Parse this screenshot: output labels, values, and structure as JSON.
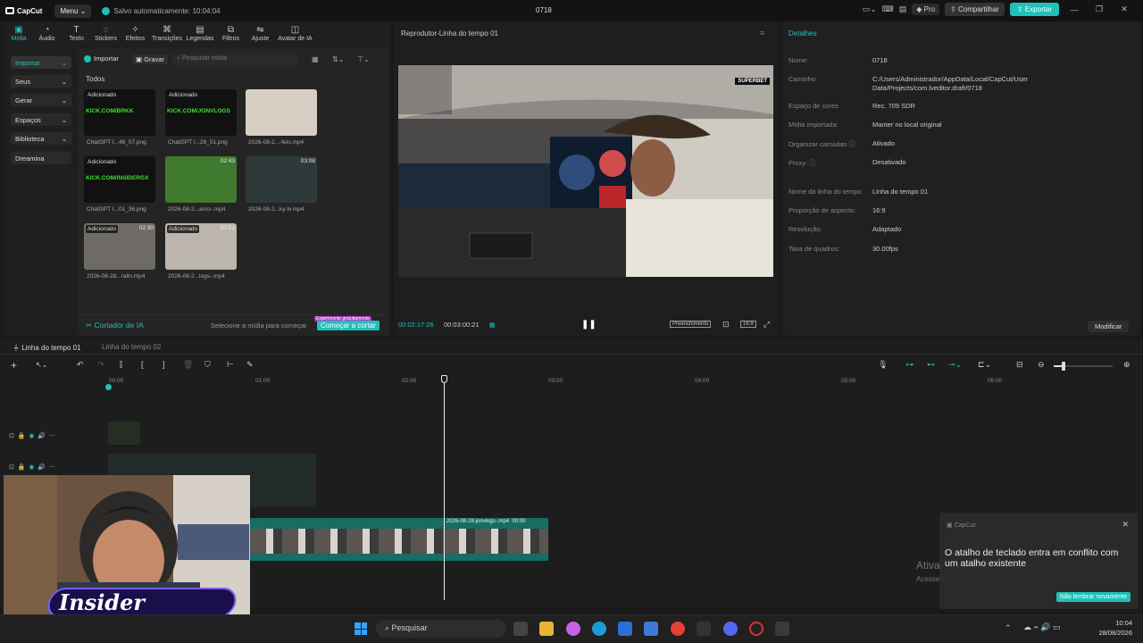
{
  "app": {
    "logo": "CapCut",
    "menu": "Menu",
    "autosave": "Salvo automaticamente: 10:04:04",
    "project_title": "0718",
    "pro": "Pro",
    "share": "Compartilhar",
    "export": "Exportar"
  },
  "tool_tabs": [
    {
      "label": "Mídia",
      "icon": "media-icon"
    },
    {
      "label": "Áudio",
      "icon": "audio-icon"
    },
    {
      "label": "Texto",
      "icon": "text-icon"
    },
    {
      "label": "Stickers",
      "icon": "sticker-icon"
    },
    {
      "label": "Efeitos",
      "icon": "effects-icon"
    },
    {
      "label": "Transições",
      "icon": "transition-icon"
    },
    {
      "label": "Legendas",
      "icon": "captions-icon"
    },
    {
      "label": "Filtros",
      "icon": "filter-icon"
    },
    {
      "label": "Ajuste",
      "icon": "adjust-icon"
    },
    {
      "label": "Avatar de IA",
      "icon": "avatar-icon"
    }
  ],
  "sidebar": {
    "items": [
      {
        "label": "Importar"
      },
      {
        "label": "Seus"
      },
      {
        "label": "Gerar"
      },
      {
        "label": "Espaços"
      },
      {
        "label": "Biblioteca"
      },
      {
        "label": "Dreamina"
      }
    ]
  },
  "media": {
    "import_btn": "Importar",
    "record_btn": "Gravar",
    "search_placeholder": "Pesquisar mídia",
    "section": "Todos",
    "items": [
      {
        "name": "ChatGPT I...48_07.png",
        "badge": "Adicionado",
        "overlay": "KICK.COM/BRKK",
        "duration": ""
      },
      {
        "name": "ChatGPT I...26_51.png",
        "badge": "Adicionado",
        "overlay": "KICK.COM/JONVLOGS",
        "duration": ""
      },
      {
        "name": "2026-08-2...-feio.mp4",
        "badge": "",
        "overlay": "",
        "duration": ""
      },
      {
        "name": "ChatGPT I...01_36.png",
        "badge": "Adicionado",
        "overlay": "KICK.COM/INSIDERGX",
        "duration": ""
      },
      {
        "name": "2026-08-2...arco-.mp4",
        "badge": "",
        "overlay": "",
        "duration": "02:43"
      },
      {
        "name": "2026-08-2...ky-lv.mp4",
        "badge": "",
        "overlay": "",
        "duration": "03:08"
      },
      {
        "name": "2026-08-28...ralin.mp4",
        "badge": "Adicionado",
        "overlay": "",
        "duration": "02:30"
      },
      {
        "name": "2026-08-2...logs-.mp4",
        "badge": "Adicionado",
        "overlay": "",
        "duration": "00:51"
      }
    ],
    "ai_cutter": "Cortador de IA",
    "ai_hint": "Selecione a mídia para começar",
    "trial_badge": "Experimente gratuitamente",
    "start_cut": "Começar a cortar"
  },
  "player": {
    "title": "Reprodutor-Linha do tempo 01",
    "overlay_brand": "SUPERBET",
    "current_time": "00:02:17:26",
    "total_time": "00:03:00:21",
    "fill_label": "Preenchimento",
    "aspect": "16:9"
  },
  "details": {
    "title": "Detalhes",
    "rows": [
      {
        "label": "Nome:",
        "value": "0718"
      },
      {
        "label": "Caminho:",
        "value": "C:/Users/Administrador/AppData/Local/CapCut/User Data/Projects/com.lveditor.draft/0718"
      },
      {
        "label": "Espaço de cores",
        "value": "Rec. 709 SDR"
      },
      {
        "label": "Mídia importada:",
        "value": "Manter no local original"
      },
      {
        "label": "Organizar camadas ⓘ",
        "value": "Ativado"
      },
      {
        "label": "Proxy: ⓘ",
        "value": "Desativado"
      },
      {
        "label": "Nome da linha do tempo",
        "value": "Linha do tempo 01"
      },
      {
        "label": "Proporção de aspecto:",
        "value": "16:9"
      },
      {
        "label": "Resolução:",
        "value": "Adaptado"
      },
      {
        "label": "Taxa de quadros:",
        "value": "30.00fps"
      }
    ],
    "modify": "Modificar"
  },
  "timeline": {
    "tabs": [
      "Linha do tempo 01",
      "Linha do tempo 02"
    ],
    "ruler": [
      "00:00",
      "01:00",
      "02:00",
      "03:00",
      "04:00",
      "05:00",
      "06:00"
    ],
    "clip_label": "2026-08-28-jonvlogs-.mp4",
    "clip_time": "00:00"
  },
  "toast": {
    "app": "CapCut",
    "message": "O atalho de teclado entra em conflito com um atalho existente",
    "dismiss": "Não lembrar novamente"
  },
  "watermark": {
    "line1": "Ativar o Windows",
    "line2": "Acesse Configurações para ativar o Windows."
  },
  "webcam": {
    "brand": "Insider"
  },
  "taskbar": {
    "search": "Pesquisar",
    "time": "10:04",
    "date": "28/08/2026"
  },
  "colors": {
    "accent": "#1fc1b8",
    "panel": "#222222",
    "toast_bg": "#2b2b2b"
  }
}
